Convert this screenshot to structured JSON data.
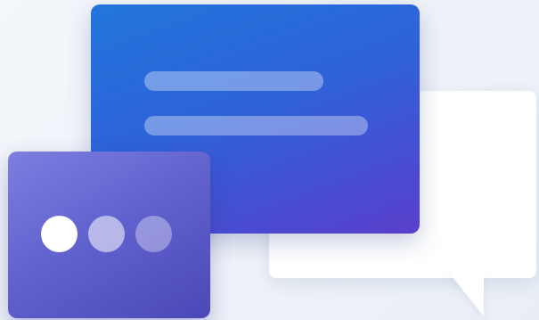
{
  "illustration": {
    "description_type": "chat-messaging-illustration",
    "colors": {
      "background": "#eef2f8",
      "blue_card_start": "#2275dc",
      "blue_card_end": "#5a3fcb",
      "purple_card_start": "#7d7ee0",
      "purple_card_end": "#4c47b8",
      "white_bubble": "#ffffff"
    },
    "icons": {
      "blue_card": "message-card-icon",
      "purple_card": "typing-indicator-icon",
      "white_bubble": "speech-bubble-icon"
    },
    "typing_dots": [
      {
        "name": "typing-dot-1",
        "opacity": 1.0
      },
      {
        "name": "typing-dot-2",
        "opacity": 0.55
      },
      {
        "name": "typing-dot-3",
        "opacity": 0.35
      }
    ],
    "text_placeholder_lines": 2
  }
}
